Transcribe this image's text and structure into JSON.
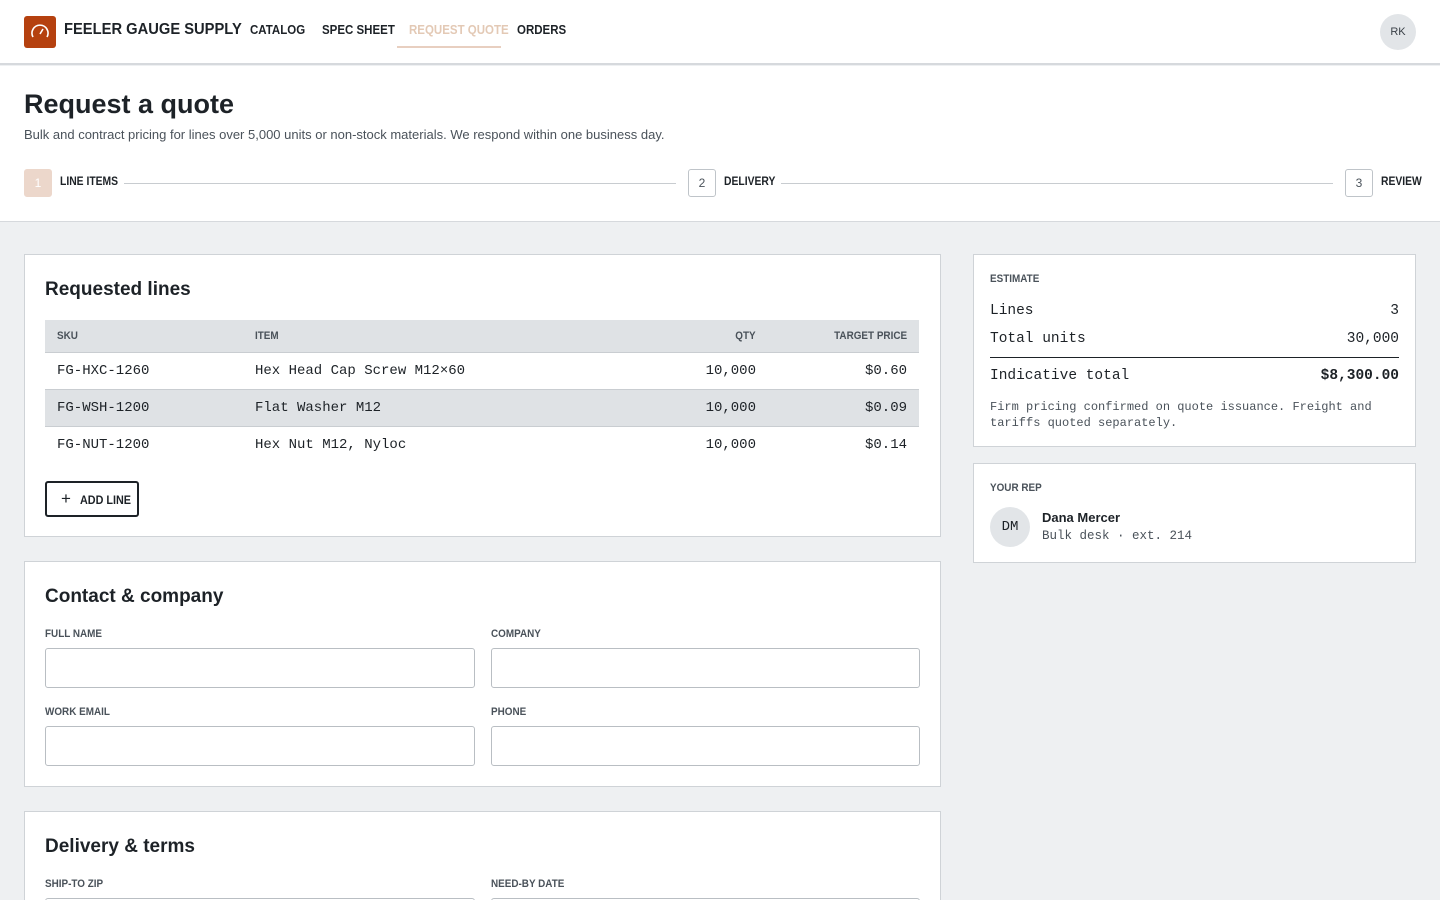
{
  "brand": {
    "name": "FEELER GAUGE SUPPLY",
    "logo_icon": "gauge-icon",
    "accent": "#b5410f"
  },
  "nav": {
    "items": [
      {
        "label": "CATALOG"
      },
      {
        "label": "SPEC SHEET"
      },
      {
        "label": "REQUEST QUOTE",
        "active": true
      },
      {
        "label": "ORDERS"
      }
    ]
  },
  "user": {
    "initials": "RK"
  },
  "page": {
    "title": "Request a quote",
    "subtitle": "Bulk and contract pricing for lines over 5,000 units or non-stock materials. We respond within one business day."
  },
  "steps": [
    {
      "num": "1",
      "label": "LINE ITEMS",
      "active": true
    },
    {
      "num": "2",
      "label": "DELIVERY"
    },
    {
      "num": "3",
      "label": "REVIEW"
    }
  ],
  "lines_card": {
    "title": "Requested lines",
    "columns": {
      "sku": "SKU",
      "item": "ITEM",
      "qty": "QTY",
      "price": "TARGET PRICE"
    },
    "rows": [
      {
        "sku": "FG-HXC-1260",
        "item": "Hex Head Cap Screw M12×60",
        "qty": "10,000",
        "price": "$0.60"
      },
      {
        "sku": "FG-WSH-1200",
        "item": "Flat Washer M12",
        "qty": "10,000",
        "price": "$0.09"
      },
      {
        "sku": "FG-NUT-1200",
        "item": "Hex Nut M12, Nyloc",
        "qty": "10,000",
        "price": "$0.14"
      }
    ],
    "add_label": "ADD LINE"
  },
  "contact_card": {
    "title": "Contact & company",
    "full_name": {
      "label": "FULL NAME",
      "value": ""
    },
    "company": {
      "label": "COMPANY",
      "value": ""
    },
    "email": {
      "label": "WORK EMAIL",
      "value": ""
    },
    "phone": {
      "label": "PHONE",
      "value": ""
    }
  },
  "delivery_card": {
    "title": "Delivery & terms",
    "zip": {
      "label": "SHIP-TO ZIP"
    },
    "date": {
      "label": "NEED-BY DATE"
    }
  },
  "estimate": {
    "label": "ESTIMATE",
    "lines_label": "Lines",
    "lines_value": "3",
    "units_label": "Total units",
    "units_value": "30,000",
    "total_label": "Indicative total",
    "total_value": "$8,300.00",
    "note": "Firm pricing confirmed on quote issuance. Freight and tariffs quoted separately."
  },
  "rep": {
    "label": "YOUR REP",
    "initials": "DM",
    "name": "Dana Mercer",
    "meta": "Bulk desk · ext. 214"
  }
}
